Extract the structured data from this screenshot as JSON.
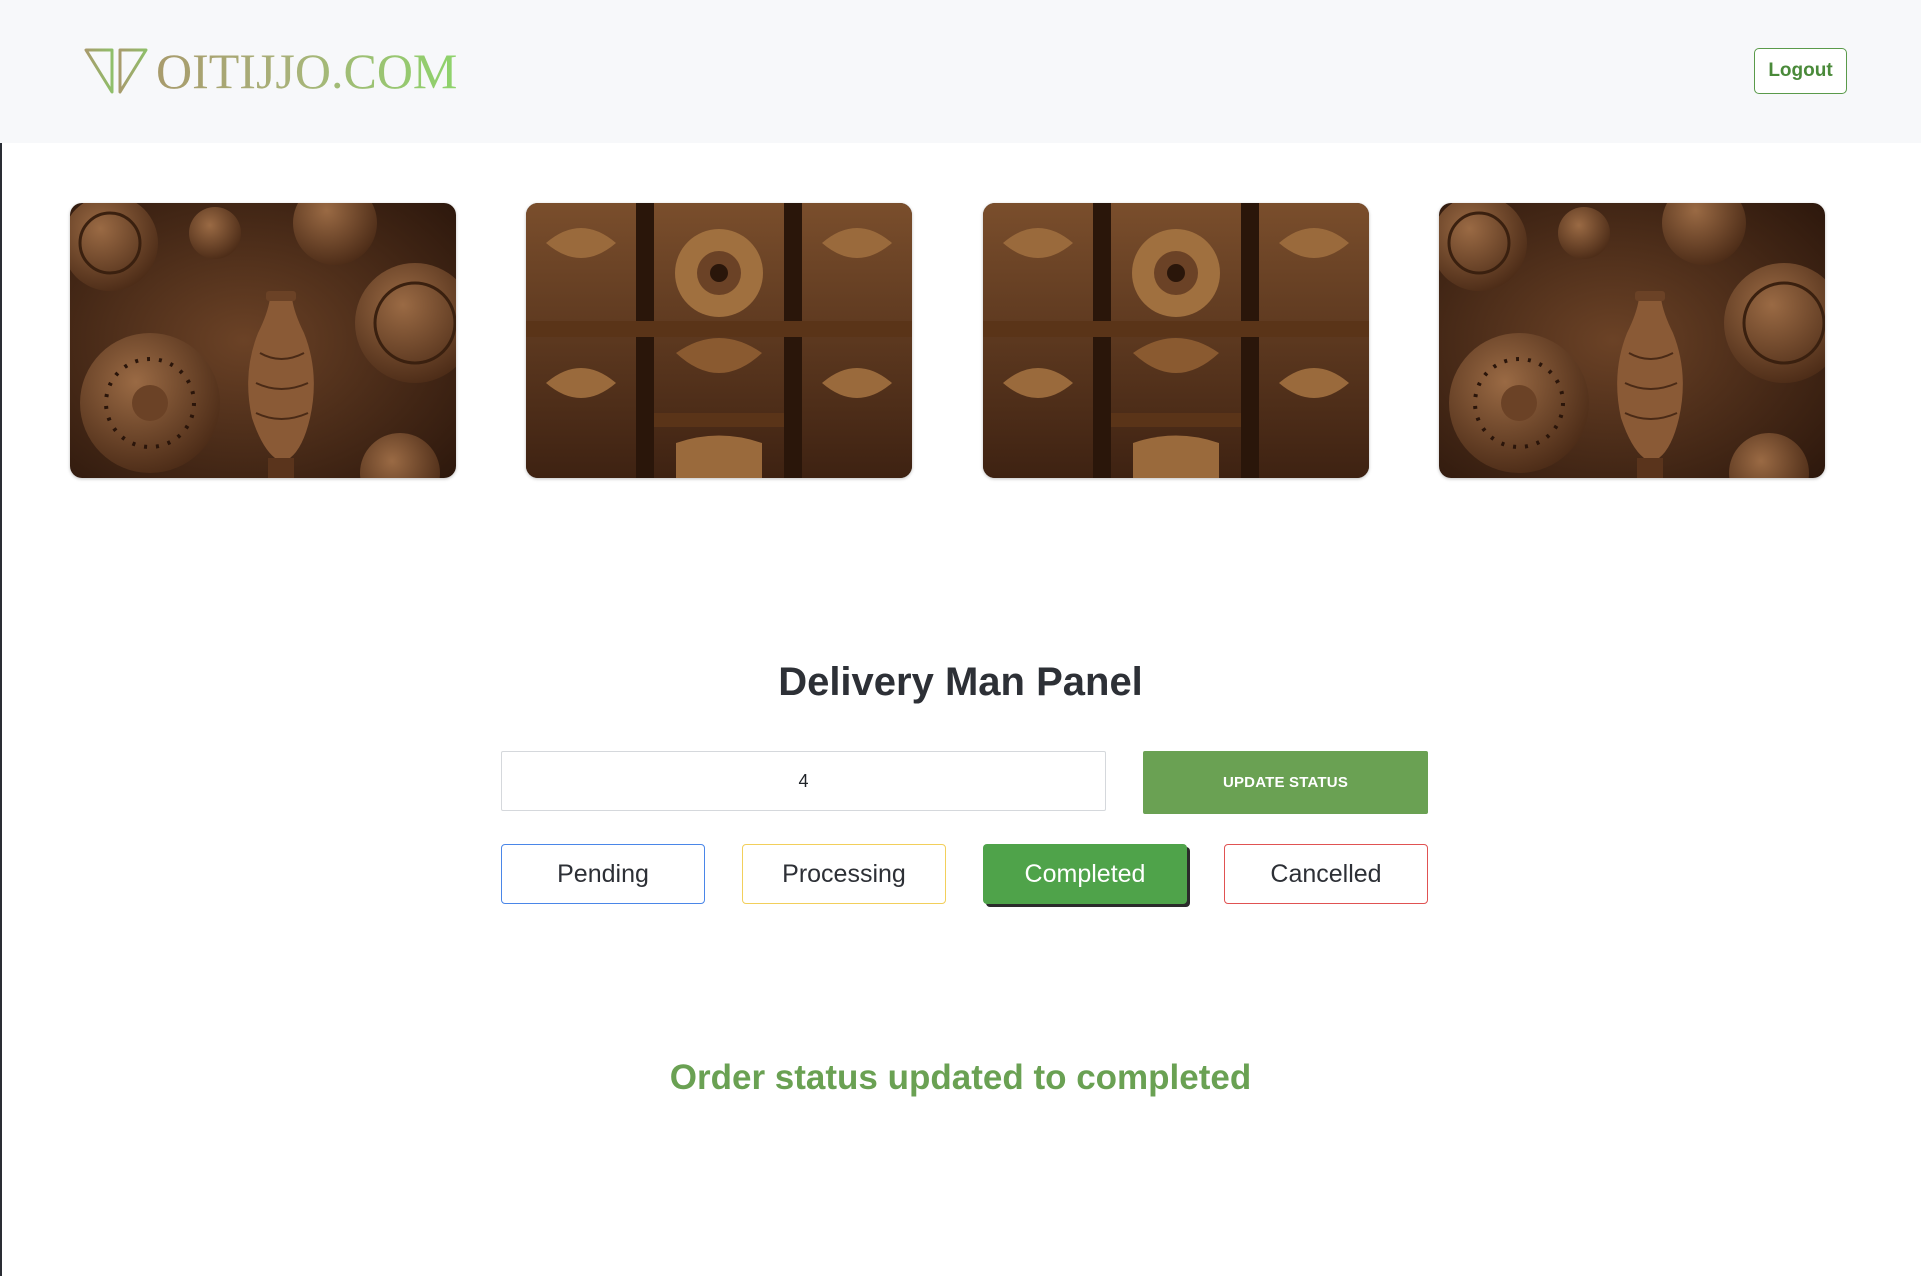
{
  "header": {
    "brand_name": "OITIJJO.COM",
    "brand_icon": "open-book-logo-icon",
    "logout_label": "Logout"
  },
  "gallery": {
    "images": [
      {
        "subject": "terracotta-pottery-with-vase"
      },
      {
        "subject": "carved-wooden-panel"
      },
      {
        "subject": "carved-wooden-panel"
      },
      {
        "subject": "terracotta-pottery-with-vase"
      }
    ]
  },
  "panel": {
    "title": "Delivery Man Panel",
    "order_input_value": "4",
    "update_button_label": "UPDATE STATUS",
    "statuses": [
      {
        "label": "Pending",
        "color": "#4a86e8",
        "selected": false
      },
      {
        "label": "Processing",
        "color": "#f2cf5b",
        "selected": false
      },
      {
        "label": "Completed",
        "color": "#4fa34a",
        "selected": true
      },
      {
        "label": "Cancelled",
        "color": "#e05252",
        "selected": false
      }
    ],
    "result_message": "Order status updated to completed"
  },
  "colors": {
    "accent_green": "#6aa153",
    "header_bg": "#f7f8fa"
  }
}
